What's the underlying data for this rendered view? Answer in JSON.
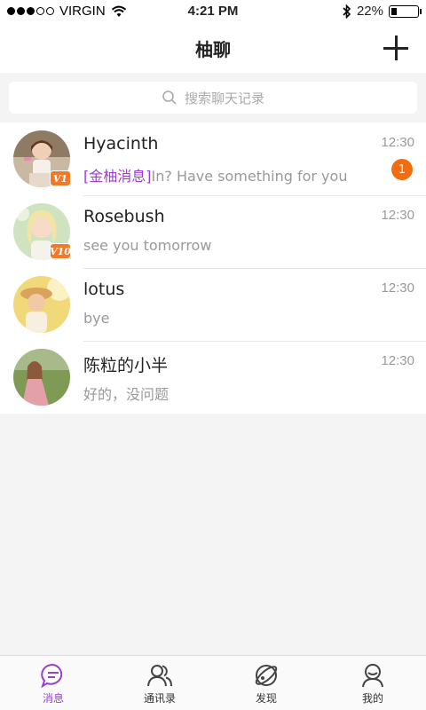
{
  "status_bar": {
    "carrier": "VIRGIN",
    "time": "4:21 PM",
    "battery": "22%",
    "battery_level": 0.22
  },
  "nav": {
    "title": "柚聊"
  },
  "search": {
    "placeholder": "搜索聊天记录"
  },
  "chats": [
    {
      "name": "Hyacinth",
      "time": "12:30",
      "tag": "[金柚消息]",
      "preview": "In? Have something for you",
      "unread": "1",
      "vip": "V1"
    },
    {
      "name": "Rosebush",
      "time": "12:30",
      "preview": "see you tomorrow",
      "vip": "V10"
    },
    {
      "name": "lotus",
      "time": "12:30",
      "preview": "bye"
    },
    {
      "name": "陈粒的小半",
      "time": "12:30",
      "preview": "好的，没问题"
    }
  ],
  "tabs": [
    {
      "label": "消息",
      "icon": "message-icon",
      "active": true
    },
    {
      "label": "通讯录",
      "icon": "contacts-icon",
      "active": false
    },
    {
      "label": "发现",
      "icon": "discover-icon",
      "active": false
    },
    {
      "label": "我的",
      "icon": "profile-icon",
      "active": false
    }
  ],
  "colors": {
    "accent": "#9b3fcf",
    "badge": "#f26c12",
    "vip": "#f07a2a"
  }
}
